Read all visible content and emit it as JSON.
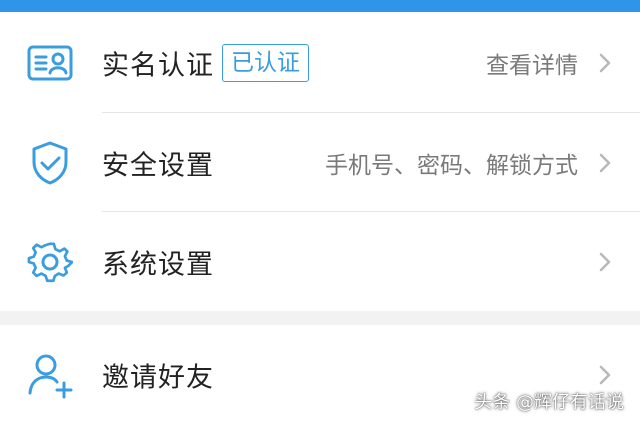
{
  "colors": {
    "accent": "#2f95e8",
    "icon": "#3a9de0",
    "text": "#222222",
    "secondary_text": "#7a7a7a",
    "chevron": "#b8b8b8",
    "background": "#ffffff",
    "section_gap": "#f2f2f2"
  },
  "menu": {
    "items": [
      {
        "icon": "id-card-icon",
        "label": "实名认证",
        "badge": "已认证",
        "detail": "查看详情"
      },
      {
        "icon": "shield-check-icon",
        "label": "安全设置",
        "detail": "手机号、密码、解锁方式"
      },
      {
        "icon": "gear-icon",
        "label": "系统设置",
        "detail": ""
      },
      {
        "icon": "add-user-icon",
        "label": "邀请好友",
        "detail": ""
      }
    ]
  },
  "watermark": "头条 @辉仔有话说"
}
